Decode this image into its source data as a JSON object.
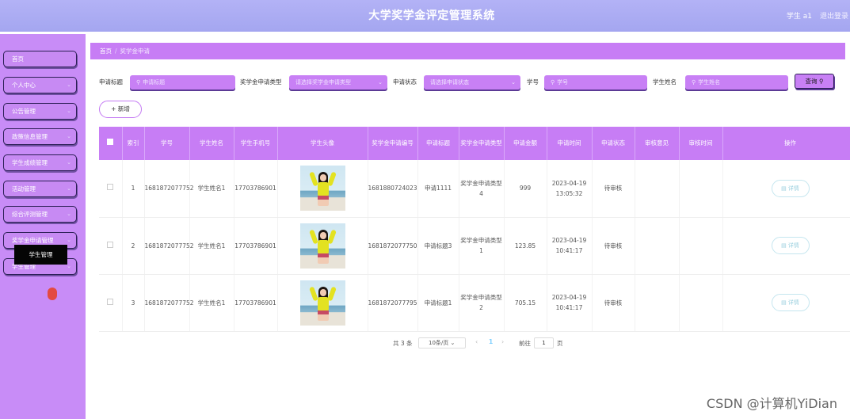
{
  "header": {
    "title": "大学奖学金评定管理系统",
    "user": "学生 a1",
    "logout": "退出登录"
  },
  "sidebar": {
    "items": [
      {
        "label": "首页"
      },
      {
        "label": "个人中心",
        "expand": true
      },
      {
        "label": "公告管理",
        "expand": true
      },
      {
        "label": "政策信息管理",
        "expand": true
      },
      {
        "label": "学生成绩管理",
        "expand": true
      },
      {
        "label": "活动管理",
        "expand": true
      },
      {
        "label": "综合评测管理",
        "expand": true
      },
      {
        "label": "奖学金申请管理",
        "expand": true
      },
      {
        "label": "学生管理",
        "expand": true
      }
    ],
    "submenu": "学生管理"
  },
  "breadcrumb": {
    "home": "首页",
    "separator": "/",
    "current": "奖学金申请"
  },
  "search": {
    "title_label": "申请标题",
    "title_placeholder": "申请标题",
    "type_label": "奖学金申请类型",
    "type_placeholder": "请选择奖学金申请类型",
    "status_label": "申请状态",
    "status_placeholder": "请选择申请状态",
    "sno_label": "学号",
    "sno_placeholder": "学号",
    "name_label": "学生姓名",
    "name_placeholder": "学生姓名",
    "query_button": "查询"
  },
  "add_button": "+ 新增",
  "table": {
    "headers": [
      "",
      "索引",
      "学号",
      "学生姓名",
      "学生手机号",
      "学生头像",
      "奖学金申请编号",
      "申请标题",
      "奖学金申请类型",
      "申请金额",
      "申请时间",
      "申请状态",
      "审核意见",
      "审核时间",
      "操作"
    ],
    "rows": [
      {
        "index": "1",
        "sno": "1681872077752",
        "name": "学生姓名1",
        "phone": "17703786901",
        "app_no": "1681880724023",
        "title": "申请1111",
        "type": "奖学金申请类型4",
        "amount": "999",
        "time": "2023-04-19 13:05:32",
        "status": "待审核",
        "opinion": "",
        "review_time": "",
        "action": "详情"
      },
      {
        "index": "2",
        "sno": "1681872077752",
        "name": "学生姓名1",
        "phone": "17703786901",
        "app_no": "1681872077750",
        "title": "申请标题3",
        "type": "奖学金申请类型1",
        "amount": "123.85",
        "time": "2023-04-19 10:41:17",
        "status": "待审核",
        "opinion": "",
        "review_time": "",
        "action": "详情"
      },
      {
        "index": "3",
        "sno": "1681872077752",
        "name": "学生姓名1",
        "phone": "17703786901",
        "app_no": "1681872077795",
        "title": "申请标题1",
        "type": "奖学金申请类型2",
        "amount": "705.15",
        "time": "2023-04-19 10:41:17",
        "status": "待审核",
        "opinion": "",
        "review_time": "",
        "action": "详情"
      }
    ]
  },
  "pagination": {
    "total": "共 3 条",
    "page_size": "10条/页",
    "current": "1",
    "goto_label": "前往",
    "goto_value": "1",
    "page_unit": "页"
  },
  "watermark": "CSDN @计算机YiDian"
}
